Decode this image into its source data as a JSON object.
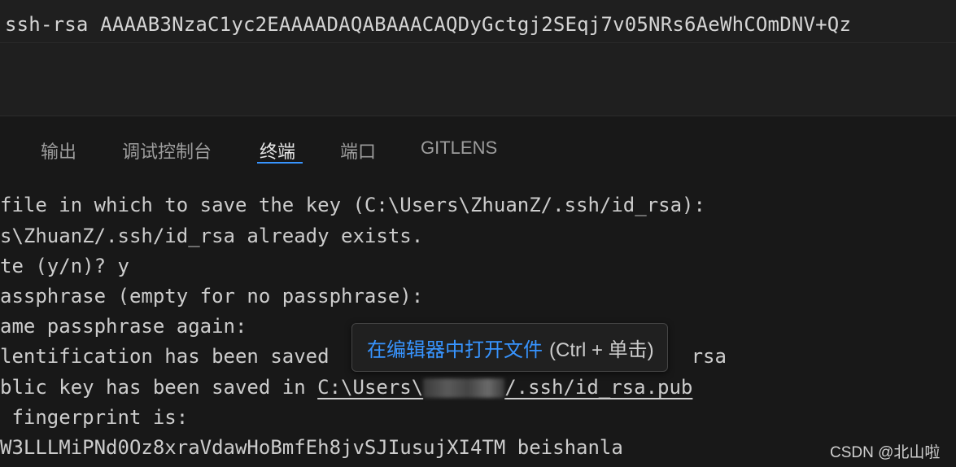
{
  "editor": {
    "top_line": "ssh-rsa AAAAB3NzaC1yc2EAAAADAQABAAACAQDyGctgj2SEqj7v05NRs6AeWhCOmDNV+Qz"
  },
  "panel": {
    "tabs": [
      {
        "label": "输出",
        "active": false
      },
      {
        "label": "调试控制台",
        "active": false
      },
      {
        "label": "终端",
        "active": true
      },
      {
        "label": "端口",
        "active": false
      },
      {
        "label": "GITLENS",
        "active": false
      }
    ]
  },
  "terminal": {
    "lines": [
      "file in which to save the key (C:\\Users\\ZhuanZ/.ssh/id_rsa):",
      "s\\ZhuanZ/.ssh/id_rsa already exists.",
      "te (y/n)? y",
      "assphrase (empty for no passphrase):",
      "ame passphrase again:",
      "lentification has been saved",
      "blic key has been saved in ",
      " fingerprint is:",
      "W3LLLMiPNd0Oz8xraVdawHoBmfEh8jvSJIusujXI4TM beishanla"
    ],
    "line6_tail": "rsa",
    "pub_link_prefix": "C:\\Users\\",
    "pub_link_suffix": "/.ssh/id_rsa.pub"
  },
  "tooltip": {
    "link_text": "在编辑器中打开文件",
    "hint_text": "(Ctrl + 单击)"
  },
  "watermark": {
    "text": "CSDN @北山啦"
  },
  "colors": {
    "accent": "#3794ff",
    "background": "#181818",
    "text": "#cccccc"
  }
}
